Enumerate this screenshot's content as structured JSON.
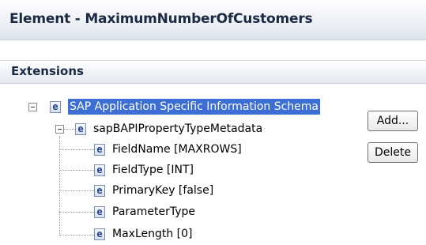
{
  "header": {
    "title": "Element - MaximumNumberOfCustomers"
  },
  "section": {
    "title": "Extensions"
  },
  "tree": {
    "icon_glyph": "e",
    "root": {
      "label": "SAP Application Specific Information Schema",
      "selected": true
    },
    "child": {
      "label": "sapBAPIPropertyTypeMetadata"
    },
    "leaves": [
      {
        "label": "FieldName [MAXROWS]"
      },
      {
        "label": "FieldType [INT]"
      },
      {
        "label": "PrimaryKey [false]"
      },
      {
        "label": "ParameterType"
      },
      {
        "label": "MaxLength [0]"
      }
    ]
  },
  "buttons": {
    "add": "Add...",
    "delete": "Delete"
  },
  "colors": {
    "selection": "#3d6ed6",
    "header_text": "#1b2a44"
  }
}
